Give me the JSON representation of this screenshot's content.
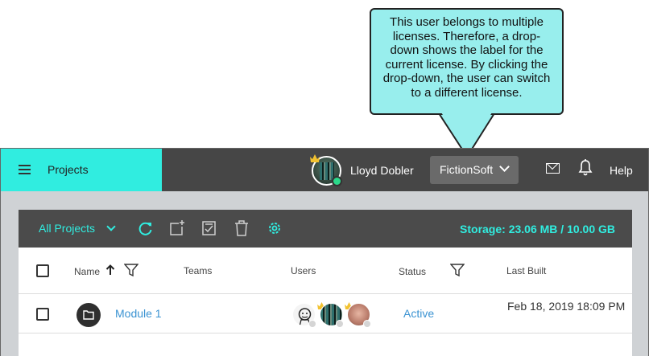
{
  "callout": {
    "text": "This user belongs to multiple licenses. Therefore, a drop-down shows the label for the current license. By clicking the drop-down, the user can switch to a different license."
  },
  "topbar": {
    "app_section": "Projects",
    "user_name": "Lloyd Dobler",
    "license_label": "FictionSoft",
    "help_label": "Help",
    "accent_color": "#30ede0",
    "bar_color": "#464646"
  },
  "toolbar": {
    "view_label": "All Projects",
    "storage_label": "Storage:",
    "storage_value": "23.06 MB / 10.00 GB",
    "icons": [
      "refresh-icon",
      "new-project-icon",
      "checklist-icon",
      "trash-icon",
      "settings-icon"
    ]
  },
  "table": {
    "columns": [
      "Name",
      "Teams",
      "Users",
      "Status",
      "Last Built"
    ],
    "rows": [
      {
        "name": "Module 1",
        "teams": "",
        "status": "Active",
        "last_built": "Feb 18, 2019 18:09 PM"
      }
    ]
  }
}
